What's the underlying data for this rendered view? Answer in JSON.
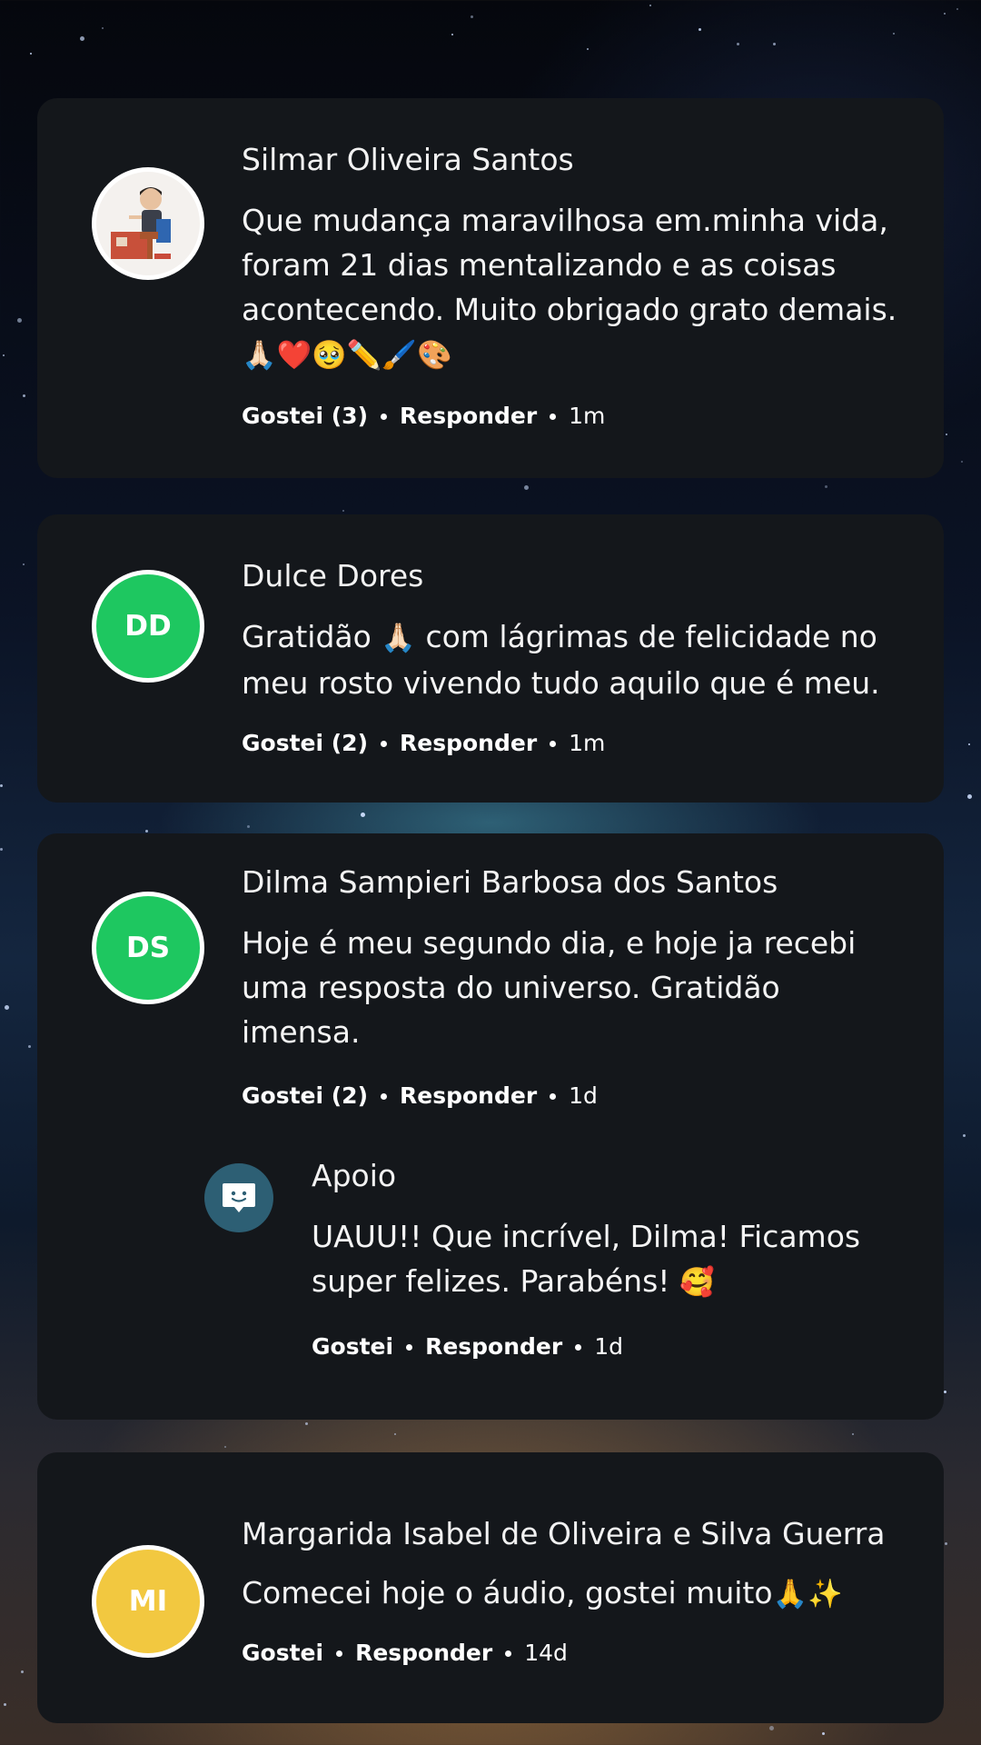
{
  "comments": [
    {
      "author": "Silmar Oliveira Santos",
      "avatar_type": "photo",
      "text": "Que mudança maravilhosa em.minha vida, foram 21 dias mentalizando e as coisas acontecendo.  Muito obrigado grato demais.",
      "emojis": "🙏🏻❤️🥹✏️🖌️🎨",
      "like_label": "Gostei (3)",
      "reply_label": "Responder",
      "time": "1m"
    },
    {
      "author": "Dulce Dores",
      "initials": "DD",
      "avatar_color": "#1ec760",
      "text_before": "Gratidão",
      "text_emoji": "🙏🏻",
      "text_after": "com lágrimas de felicidade no meu rosto vivendo tudo aquilo que é meu.",
      "like_label": "Gostei (2)",
      "reply_label": "Responder",
      "time": "1m"
    },
    {
      "author": "Dilma Sampieri Barbosa dos Santos",
      "initials": "DS",
      "avatar_color": "#1ec760",
      "text": "Hoje é  meu segundo dia, e hoje ja recebi uma resposta do universo. Gratidão imensa.",
      "like_label": "Gostei (2)",
      "reply_label": "Responder",
      "time": "1d",
      "reply": {
        "author": "Apoio",
        "avatar_color": "#2d5f74",
        "text": "UAUU!! Que incrível, Dilma! Ficamos super felizes. Parabéns!",
        "emoji": "🥰",
        "like_label": "Gostei",
        "reply_label": "Responder",
        "time": "1d"
      }
    },
    {
      "author": "Margarida Isabel de Oliveira e Silva Guerra",
      "initials": "MI",
      "avatar_color": "#f2c840",
      "text": "Comecei hoje o áudio,  gostei muito",
      "emojis": "🙏✨",
      "like_label": "Gostei",
      "reply_label": "Responder",
      "time": "14d"
    }
  ]
}
